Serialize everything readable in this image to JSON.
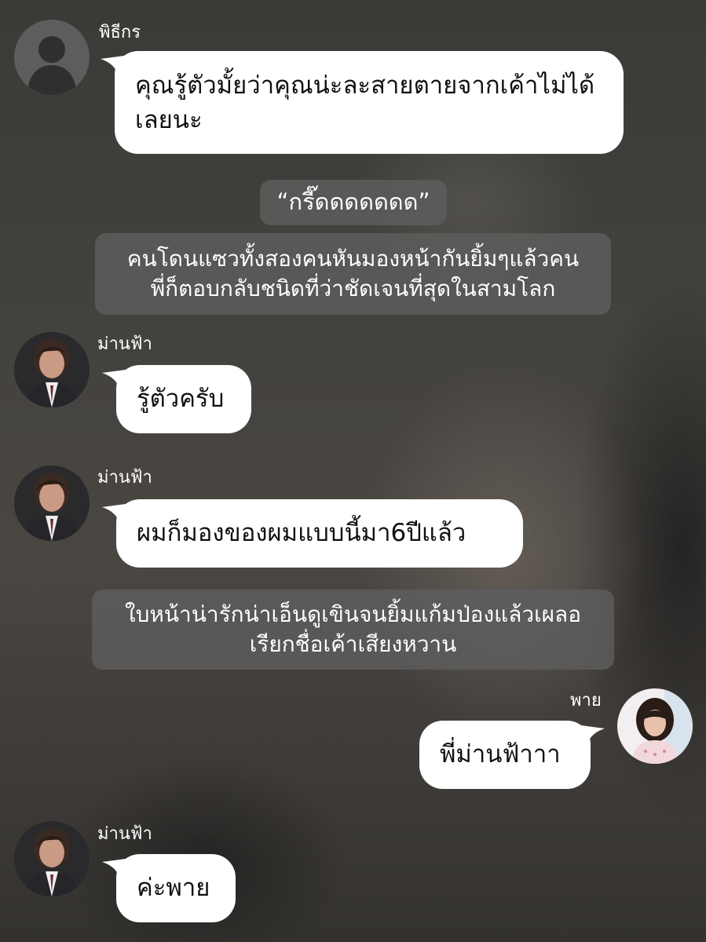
{
  "messages": [
    {
      "sender": "พิธีกร",
      "text": "คุณรู้ตัวมั้ยว่าคุณน่ะละสายตายจากเค้าไม่ได้เลยนะ"
    },
    {
      "narration": "“กรี๊ดดดดดดด”"
    },
    {
      "narration": "คนโดนแซวทั้งสองคนหันมองหน้ากันยิ้มๆแล้วคนพี่ก็ตอบกลับชนิดที่ว่าชัดเจนที่สุดในสามโลก"
    },
    {
      "sender": "ม่านฟ้า",
      "text": "รู้ตัวครับ"
    },
    {
      "sender": "ม่านฟ้า",
      "text": "ผมก็มองของผมแบบนี้มา6ปีแล้ว"
    },
    {
      "narration": "ใบหน้าน่ารักน่าเอ็นดูเขินจนยิ้มแก้มป่องแล้วเผลอเรียกชื่อเค้าเสียงหวาน"
    },
    {
      "sender": "พาย",
      "text": "พี่ม่านฟ้าาา"
    },
    {
      "sender": "ม่านฟ้า",
      "text": "ค่ะพาย"
    }
  ],
  "colors": {
    "bubble": "#ffffff",
    "narration_box": "#5f5f5f",
    "background": "#3e3d3b"
  }
}
